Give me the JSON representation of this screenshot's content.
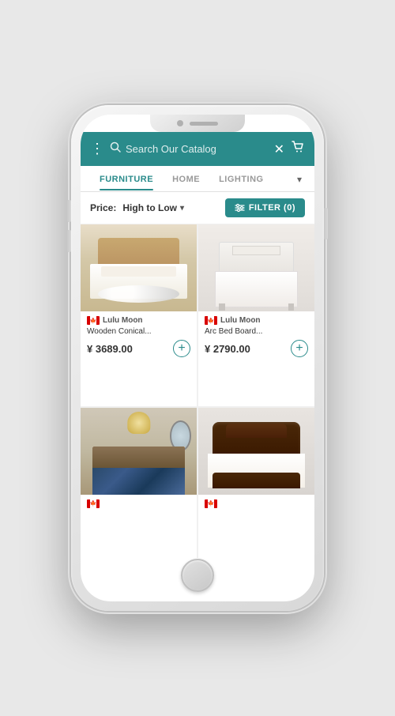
{
  "phone": {
    "status": ""
  },
  "header": {
    "dots_label": "⋮",
    "search_placeholder": "Search Our Catalog",
    "close_icon": "✕",
    "cart_icon": "🛒"
  },
  "nav": {
    "tabs": [
      {
        "label": "FURNITURE",
        "active": true
      },
      {
        "label": "HOME",
        "active": false
      },
      {
        "label": "LIGHTING",
        "active": false
      }
    ],
    "more_icon": "▾"
  },
  "filter_bar": {
    "price_label": "Price:",
    "sort_label": "High to Low",
    "sort_arrow": "▾",
    "filter_icon": "⚙",
    "filter_label": "FILTER (0)"
  },
  "products": [
    {
      "id": "1",
      "brand": "Lulu Moon",
      "name": "Wooden Conical...",
      "price": "¥ 3689.00",
      "flag": "canada",
      "add_label": "+"
    },
    {
      "id": "2",
      "brand": "Lulu Moon",
      "name": "Arc Bed Board...",
      "price": "¥ 2790.00",
      "flag": "canada",
      "add_label": "+"
    },
    {
      "id": "3",
      "brand": "",
      "name": "",
      "price": "",
      "flag": "canada",
      "add_label": "+"
    },
    {
      "id": "4",
      "brand": "",
      "name": "",
      "price": "",
      "flag": "canada",
      "add_label": "+"
    }
  ]
}
